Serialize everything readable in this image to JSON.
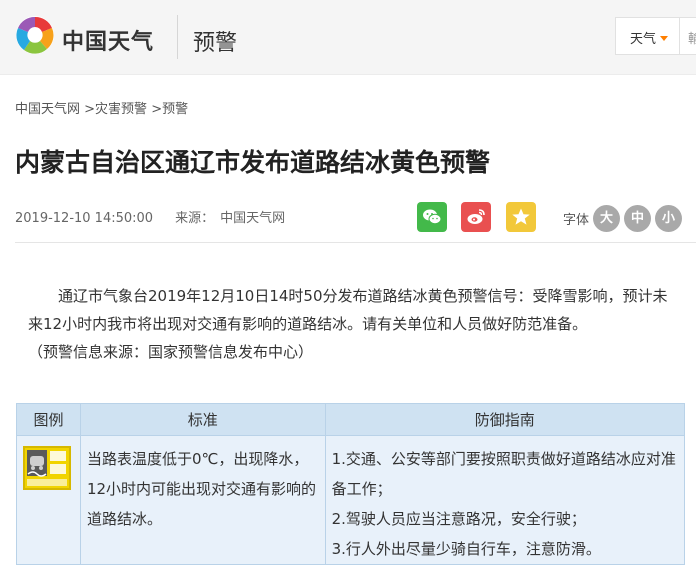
{
  "header": {
    "brand": "中国天气",
    "section": "预警",
    "weather_select": "天气",
    "search_fragment": "輸"
  },
  "breadcrumb": {
    "home": "中国天气网",
    "sep1": " >",
    "disaster": "灾害预警",
    "sep2": " >",
    "warning": "预警"
  },
  "article": {
    "title": "内蒙古自治区通辽市发布道路结冰黄色预警",
    "datetime": "2019-12-10 14:50:00",
    "source_label": "来源：",
    "source_value": "中国天气网",
    "font_label": "字体",
    "font_large": "大",
    "font_medium": "中",
    "font_small": "小",
    "paragraph": "通辽市气象台2019年12月10日14时50分发布道路结冰黄色预警信号：受降雪影响，预计未来12小时内我市将出现对交通有影响的道路结冰。请有关单位和人员做好防范准备。",
    "origin": "（预警信息来源：国家预警信息发布中心）"
  },
  "share_icons": [
    "wechat-icon",
    "weibo-icon",
    "favorite-star-icon"
  ],
  "table": {
    "headers": {
      "icon": "图例",
      "standard": "标准",
      "guide": "防御指南"
    },
    "standard_text": "当路表温度低于0℃，出现降水，12小时内可能出现对交通有影响的道路结冰。",
    "guide": [
      "1.交通、公安等部门要按照职责做好道路结冰应对准备工作；",
      "2.驾驶人员应当注意路况，安全行驶；",
      "3.行人外出尽量少骑自行车，注意防滑。"
    ],
    "warning_icon": "road-icing-yellow-warning-icon"
  },
  "colors": {
    "wechat": "#43b94a",
    "weibo": "#e95050",
    "favorite": "#f2c83a",
    "table_header": "#cfe2f2",
    "table_cell": "#e8f1fa",
    "warning_yellow": "#f1d400"
  }
}
